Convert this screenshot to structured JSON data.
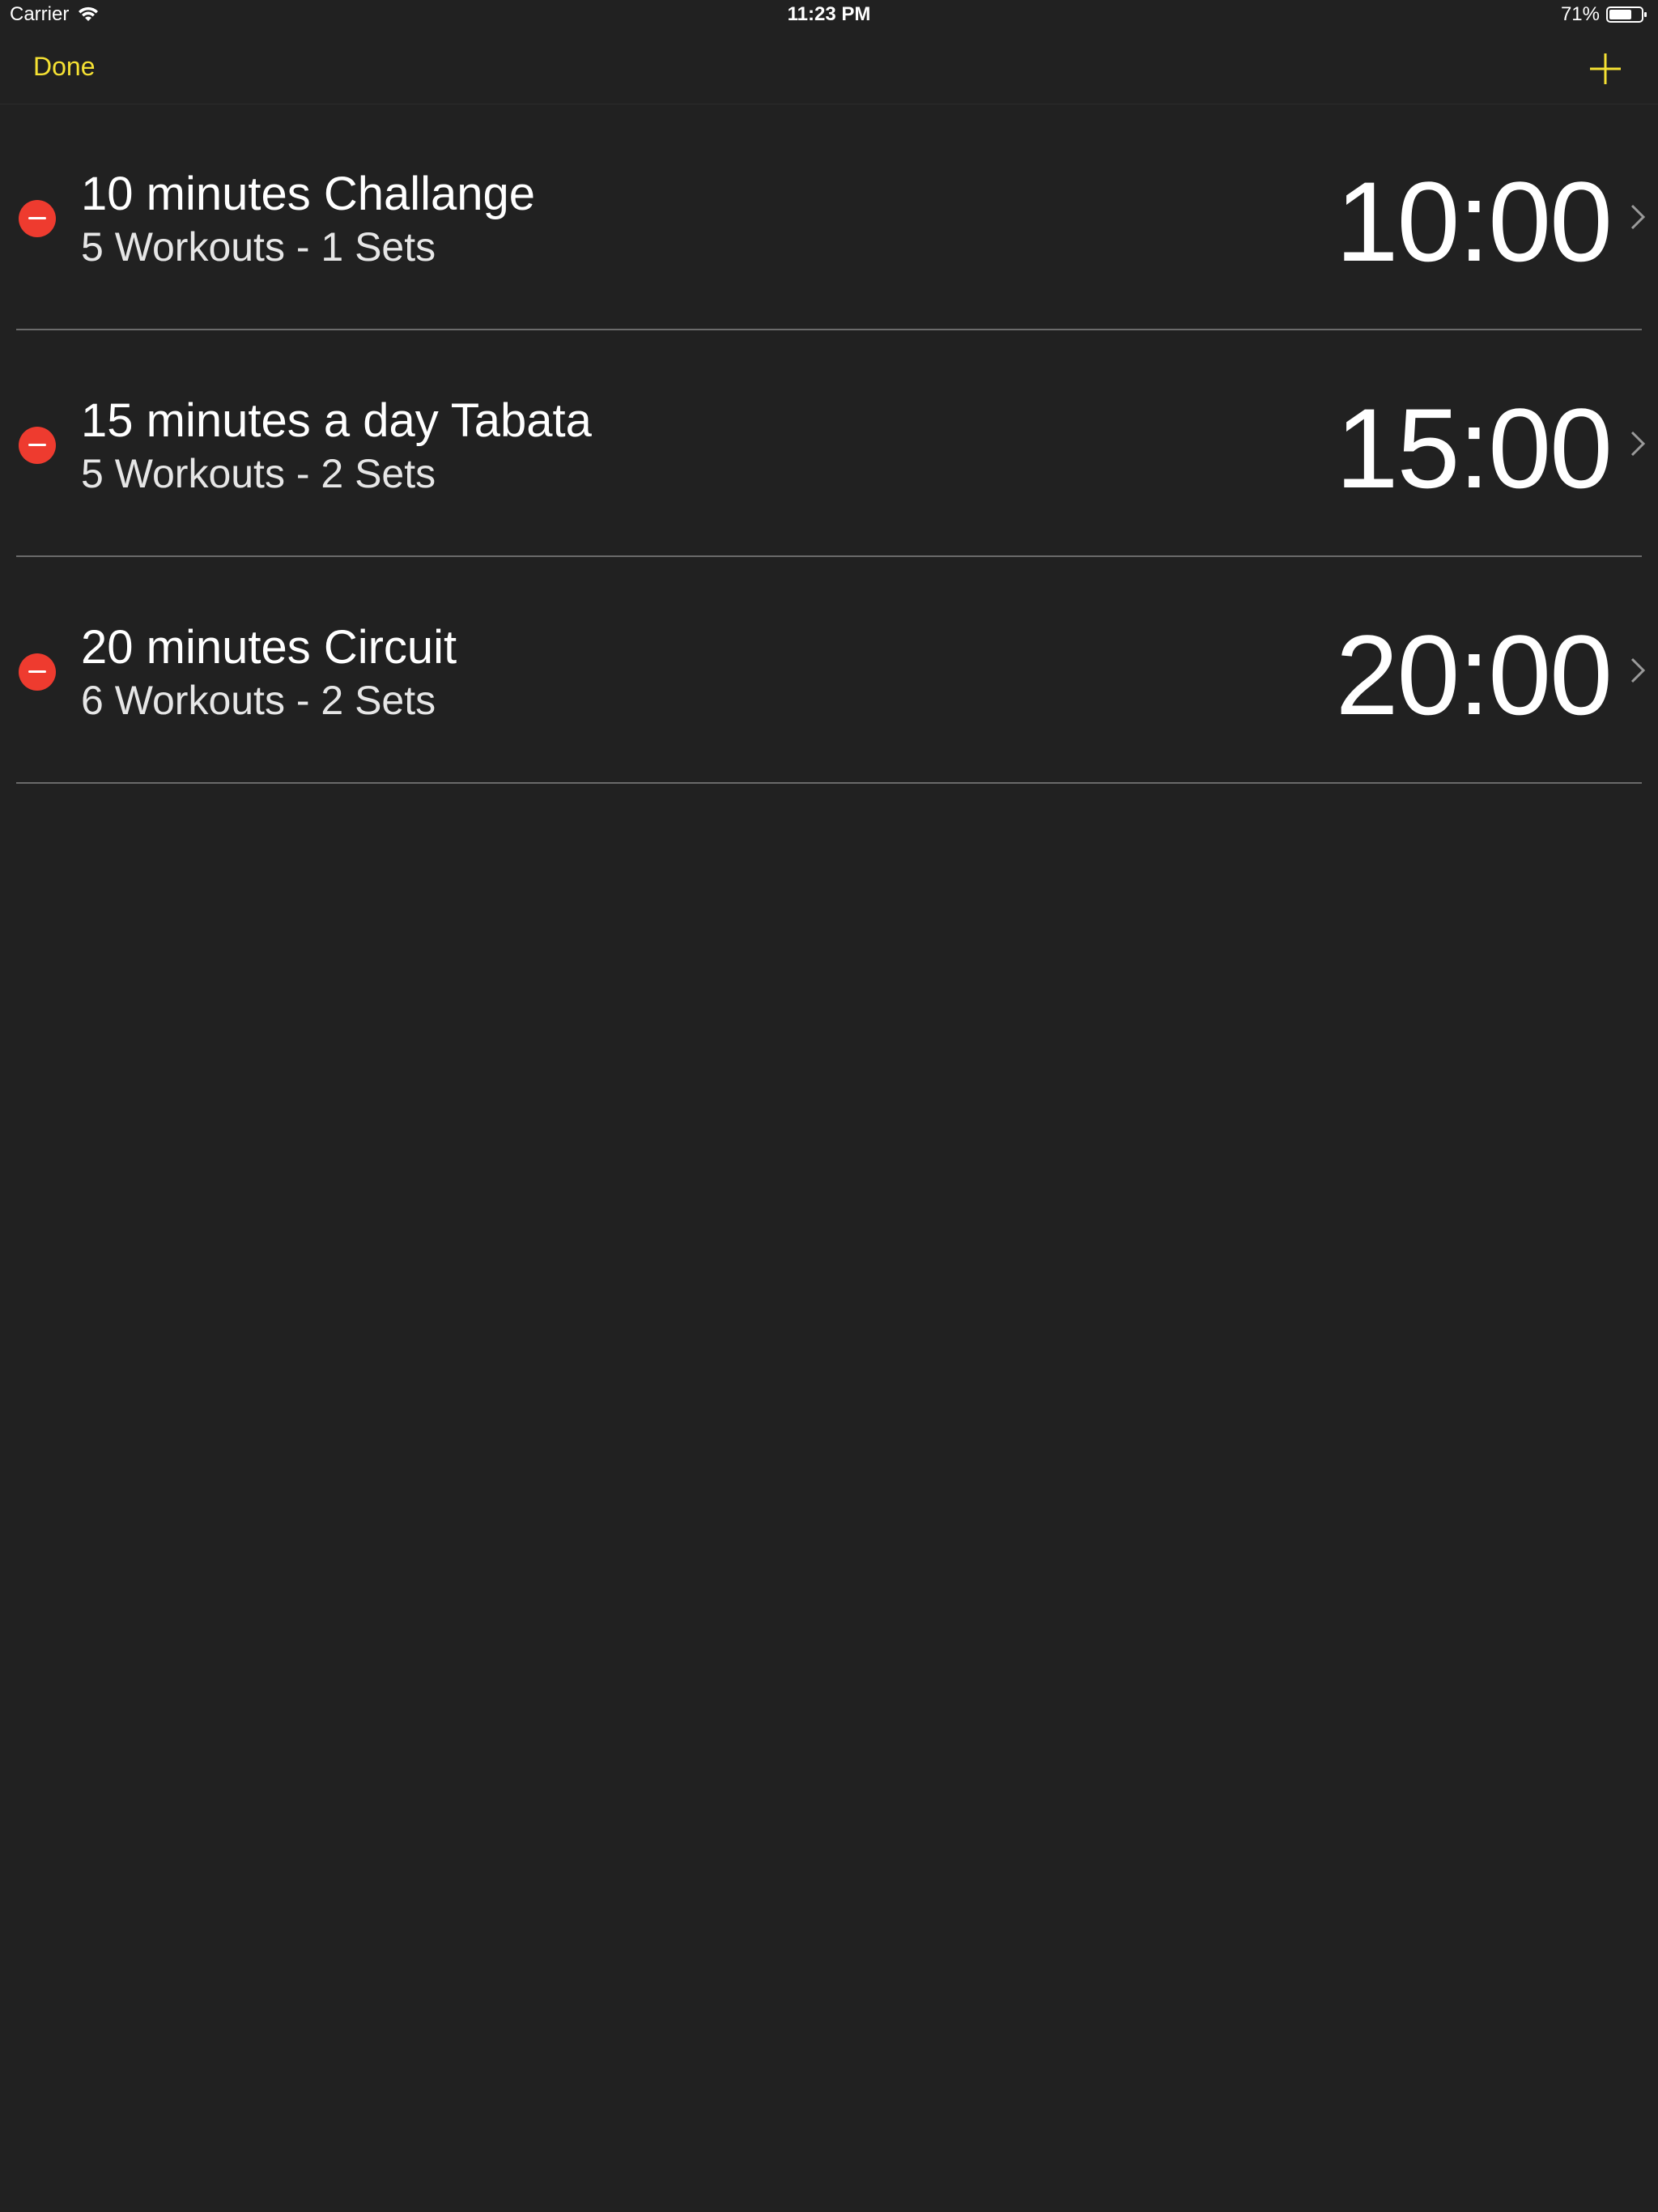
{
  "status_bar": {
    "carrier": "Carrier",
    "time": "11:23 PM",
    "battery": "71%",
    "battery_level": 0.71,
    "wifi_icon": "wifi-icon",
    "battery_icon": "battery-icon"
  },
  "nav": {
    "done_label": "Done",
    "add_icon": "plus-icon",
    "accent_color": "#f5e133"
  },
  "workouts": [
    {
      "title": "10 minutes Challange",
      "subtitle": "5 Workouts - 1 Sets",
      "duration": "10:00"
    },
    {
      "title": "15 minutes a day Tabata",
      "subtitle": "5 Workouts - 2 Sets",
      "duration": "15:00"
    },
    {
      "title": "20 minutes Circuit",
      "subtitle": "6 Workouts - 2 Sets",
      "duration": "20:00"
    }
  ],
  "colors": {
    "background": "#212121",
    "delete": "#ee3b2f",
    "separator": "#6b6b6b"
  }
}
